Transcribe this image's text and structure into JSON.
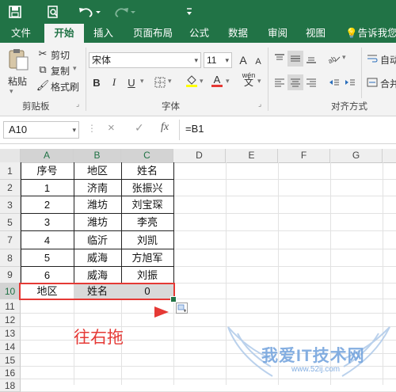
{
  "quick_access": {
    "save_icon": "save-icon",
    "preview_icon": "print-preview-icon",
    "undo_icon": "undo-icon",
    "redo_icon": "redo-icon"
  },
  "tabs": [
    {
      "label": "文件"
    },
    {
      "label": "开始"
    },
    {
      "label": "插入"
    },
    {
      "label": "页面布局"
    },
    {
      "label": "公式"
    },
    {
      "label": "数据"
    },
    {
      "label": "审阅"
    },
    {
      "label": "视图"
    }
  ],
  "tell_me": "告诉我您想",
  "ribbon": {
    "clipboard": {
      "paste": "粘贴",
      "cut": "剪切",
      "copy": "复制",
      "format_painter": "格式刷",
      "group": "剪贴板"
    },
    "font": {
      "name": "宋体",
      "size": "11",
      "grow": "A",
      "shrink": "A",
      "bold": "B",
      "italic": "I",
      "underline": "U",
      "font_color": "A",
      "wen": "wén",
      "group": "字体"
    },
    "alignment": {
      "wrap": "自动",
      "merge": "合并",
      "group": "对齐方式"
    }
  },
  "formula_bar": {
    "name_box": "A10",
    "cancel": "×",
    "enter": "✓",
    "fx": "fx",
    "formula": "=B1"
  },
  "columns": [
    "A",
    "B",
    "C",
    "D",
    "E",
    "F",
    "G"
  ],
  "rows": [
    {
      "num": "1",
      "a": "序号",
      "b": "地区",
      "c": "姓名"
    },
    {
      "num": "2",
      "a": "1",
      "b": "济南",
      "c": "张振兴"
    },
    {
      "num": "3",
      "a": "2",
      "b": "潍坊",
      "c": "刘宝琛"
    },
    {
      "num": "5",
      "a": "3",
      "b": "潍坊",
      "c": "李亮"
    },
    {
      "num": "7",
      "a": "4",
      "b": "临沂",
      "c": "刘凯"
    },
    {
      "num": "8",
      "a": "5",
      "b": "威海",
      "c": "方旭军"
    },
    {
      "num": "9",
      "a": "6",
      "b": "威海",
      "c": "刘振"
    },
    {
      "num": "10",
      "a": "地区",
      "b": "姓名",
      "c": "0"
    },
    {
      "num": "11",
      "a": "",
      "b": "",
      "c": ""
    },
    {
      "num": "12",
      "a": "",
      "b": "",
      "c": ""
    },
    {
      "num": "13",
      "a": "",
      "b": "",
      "c": ""
    },
    {
      "num": "14",
      "a": "",
      "b": "",
      "c": ""
    },
    {
      "num": "15",
      "a": "",
      "b": "",
      "c": ""
    },
    {
      "num": "16",
      "a": "",
      "b": "",
      "c": ""
    },
    {
      "num": "18",
      "a": "",
      "b": "",
      "c": ""
    }
  ],
  "annotation": {
    "text": "往右拖",
    "color": "#e53935"
  },
  "watermark": {
    "text": "我爱IT技术网",
    "url": "www.52ij.com"
  },
  "colors": {
    "excel_green": "#217346",
    "highlight": "#e53935"
  }
}
